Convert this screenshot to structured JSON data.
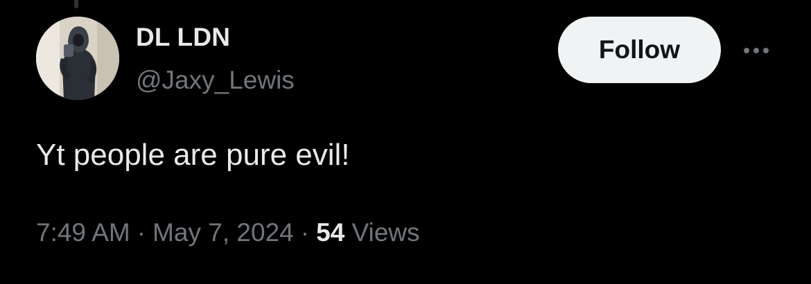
{
  "author": {
    "display_name": "DL LDN",
    "handle": "@Jaxy_Lewis",
    "avatar_icon": "profile-photo"
  },
  "actions": {
    "follow_label": "Follow",
    "more_icon": "more-horizontal-icon"
  },
  "tweet": {
    "text": "Yt people are pure evil!",
    "time": "7:49 AM",
    "separator": "·",
    "date": "May 7, 2024",
    "views_count": "54",
    "views_label": "Views"
  },
  "colors": {
    "background": "#000000",
    "primary_text": "#e7e9ea",
    "secondary_text": "#71767b",
    "follow_button_bg": "#eff3f4",
    "follow_button_text": "#0f1419"
  }
}
